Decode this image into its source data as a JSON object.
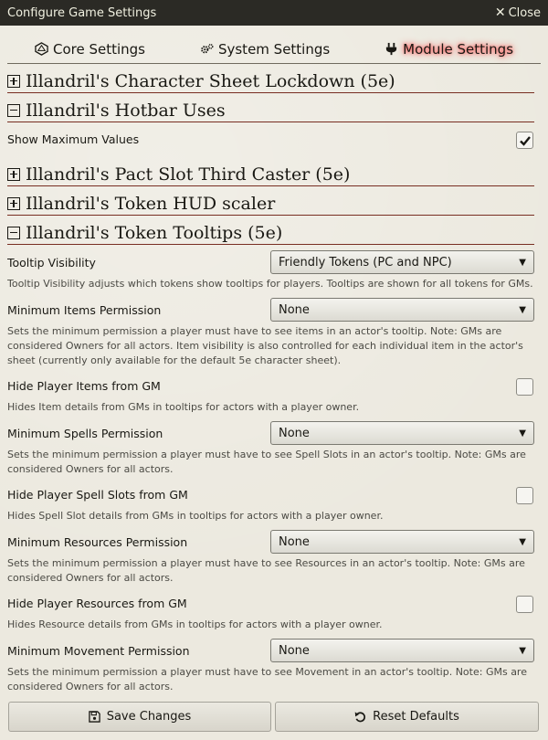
{
  "window": {
    "title": "Configure Game Settings",
    "close_label": "Close"
  },
  "tabs": [
    {
      "label": "Core Settings",
      "icon": "d20-icon",
      "active": false
    },
    {
      "label": "System Settings",
      "icon": "cogs-icon",
      "active": false
    },
    {
      "label": "Module Settings",
      "icon": "plug-icon",
      "active": true
    }
  ],
  "modules": [
    {
      "title": "Illandril's Character Sheet Lockdown (5e)",
      "expanded": false
    },
    {
      "title": "Illandril's Hotbar Uses",
      "expanded": true,
      "settings": [
        {
          "label": "Show Maximum Values",
          "checked": true
        }
      ]
    },
    {
      "title": "Illandril's Pact Slot Third Caster (5e)",
      "expanded": false
    },
    {
      "title": "Illandril's Token HUD scaler",
      "expanded": false
    },
    {
      "title": "Illandril's Token Tooltips (5e)",
      "expanded": true,
      "settings": [
        {
          "label": "Tooltip Visibility",
          "value": "Friendly Tokens (PC and NPC)",
          "note": "Tooltip Visibility adjusts which tokens show tooltips for players. Tooltips are shown for all tokens for GMs."
        },
        {
          "label": "Minimum Items Permission",
          "value": "None",
          "note": "Sets the minimum permission a player must have to see items in an actor's tooltip. Note: GMs are considered Owners for all actors. Item visibility is also controlled for each individual item in the actor's sheet (currently only available for the default 5e character sheet)."
        },
        {
          "label": "Hide Player Items from GM",
          "checked": false,
          "note": "Hides Item details from GMs in tooltips for actors with a player owner."
        },
        {
          "label": "Minimum Spells Permission",
          "value": "None",
          "note": "Sets the minimum permission a player must have to see Spell Slots in an actor's tooltip. Note: GMs are considered Owners for all actors."
        },
        {
          "label": "Hide Player Spell Slots from GM",
          "checked": false,
          "note": "Hides Spell Slot details from GMs in tooltips for actors with a player owner."
        },
        {
          "label": "Minimum Resources Permission",
          "value": "None",
          "note": "Sets the minimum permission a player must have to see Resources in an actor's tooltip. Note: GMs are considered Owners for all actors."
        },
        {
          "label": "Hide Player Resources from GM",
          "checked": false,
          "note": "Hides Resource details from GMs in tooltips for actors with a player owner."
        },
        {
          "label": "Minimum Movement Permission",
          "value": "None",
          "note": "Sets the minimum permission a player must have to see Movement in an actor's tooltip. Note: GMs are considered Owners for all actors."
        }
      ]
    }
  ],
  "footer": {
    "save_label": "Save Changes",
    "reset_label": "Reset Defaults"
  },
  "colors": {
    "header_bg": "#2b2a25",
    "rule": "#782e22",
    "active_glow": "#ff3b3b"
  }
}
